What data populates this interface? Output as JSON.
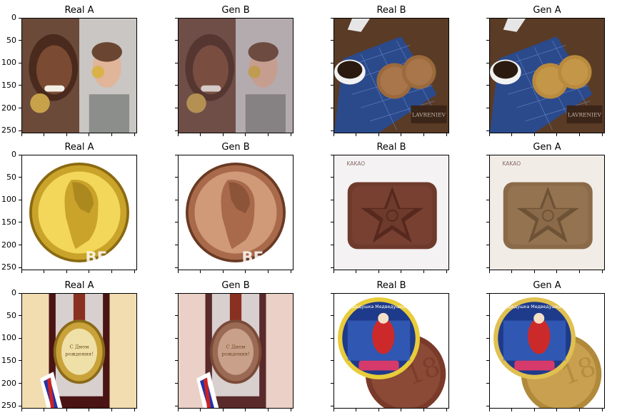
{
  "figure": {
    "panels": [
      {
        "title": "Real A",
        "image": "athletes-with-medals",
        "show_yticks": true
      },
      {
        "title": "Gen B",
        "image": "athletes-with-chocolate-medals",
        "show_yticks": false
      },
      {
        "title": "Real B",
        "image": "chocolate-coins-with-coffee",
        "show_yticks": false
      },
      {
        "title": "Gen A",
        "image": "golden-coins-with-coffee",
        "show_yticks": false
      },
      {
        "title": "Real A",
        "image": "gold-portrait-medal",
        "show_yticks": true
      },
      {
        "title": "Gen B",
        "image": "bronze-portrait-medal",
        "show_yticks": false
      },
      {
        "title": "Real B",
        "image": "chocolate-star-bar",
        "show_yticks": false
      },
      {
        "title": "Gen A",
        "image": "light-chocolate-star-bar",
        "show_yticks": false
      },
      {
        "title": "Real A",
        "image": "birthday-medal-in-box",
        "show_yticks": true
      },
      {
        "title": "Gen B",
        "image": "bronze-birthday-medal-in-box",
        "show_yticks": false
      },
      {
        "title": "Real B",
        "image": "chocolate-santa-coin",
        "show_yticks": false
      },
      {
        "title": "Gen A",
        "image": "golden-santa-coin",
        "show_yticks": false
      }
    ],
    "watermarks": {
      "lavrenev": "LAVRENIEV",
      "best": "BEST",
      "kakao": "KAKAO",
      "birthday": "С Днем рождения!",
      "santa": "Дедушка Медведушка"
    }
  },
  "chart_data": {
    "type": "image-grid",
    "rows": 3,
    "cols": 4,
    "yticks": [
      0,
      50,
      100,
      150,
      200,
      250
    ],
    "ylim": [
      256,
      0
    ],
    "titles": [
      "Real A",
      "Gen B",
      "Real B",
      "Gen A"
    ]
  }
}
